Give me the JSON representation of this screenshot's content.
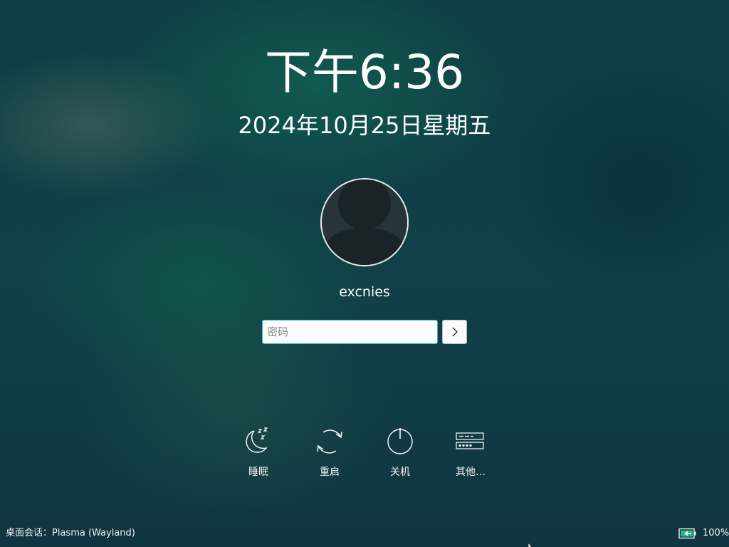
{
  "clock": {
    "time": "下午6:36"
  },
  "date": {
    "text": "2024年10月25日星期五"
  },
  "user": {
    "name": "excnies"
  },
  "password": {
    "placeholder": "密码",
    "value": ""
  },
  "actions": [
    {
      "label": "睡眠",
      "icon": "sleep-icon"
    },
    {
      "label": "重启",
      "icon": "restart-icon"
    },
    {
      "label": "关机",
      "icon": "shutdown-icon"
    },
    {
      "label": "其他…",
      "icon": "switch-user-icon"
    }
  ],
  "session": {
    "text": "桌面会话：Plasma (Wayland)"
  },
  "battery": {
    "percent": "100%",
    "icon": "battery-charging-icon"
  },
  "colors": {
    "accent": "#3daee9",
    "text": "#ffffff",
    "background": "#123a44"
  }
}
